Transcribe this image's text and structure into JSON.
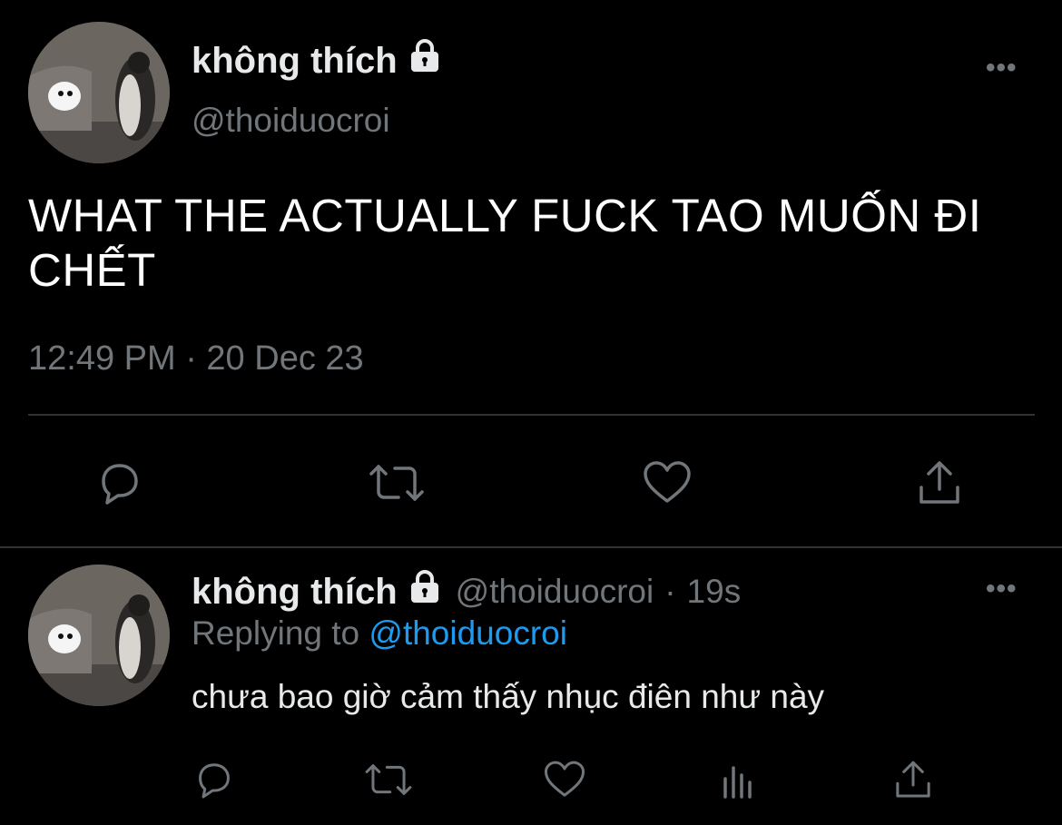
{
  "main_tweet": {
    "display_name": "không thích",
    "handle": "@thoiduocroi",
    "text": "WHAT THE ACTUALLY FUCK TAO MUỐN ĐI CHẾT",
    "timestamp": "12:49 PM · 20 Dec 23",
    "more_label": "•••",
    "icons": [
      "reply-icon",
      "retweet-icon",
      "like-icon",
      "share-icon"
    ]
  },
  "reply_tweet": {
    "display_name": "không thích",
    "handle": "@thoiduocroi",
    "separator": "·",
    "age": "19s",
    "replying_prefix": "Replying to",
    "replying_to": "@thoiduocroi",
    "text": "chưa bao giờ cảm thấy nhục điên như này",
    "more_label": "•••",
    "icons": [
      "reply-icon",
      "retweet-icon",
      "like-icon",
      "analytics-icon",
      "share-icon"
    ]
  },
  "colors": {
    "background": "#000000",
    "text": "#e7e9ea",
    "secondary": "#71767b",
    "link": "#1d9bf0",
    "divider": "#2f3336"
  }
}
